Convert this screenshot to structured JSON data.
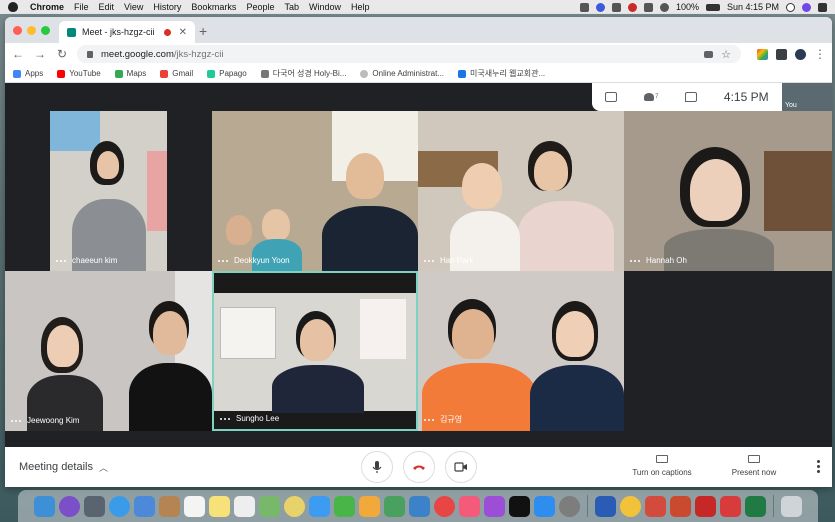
{
  "menubar": {
    "app": "Chrome",
    "items": [
      "File",
      "Edit",
      "View",
      "History",
      "Bookmarks",
      "People",
      "Tab",
      "Window",
      "Help"
    ],
    "battery": "100%",
    "datetime": "Sun 4:15 PM"
  },
  "browser": {
    "tab_title": "Meet - jks-hzgz-cii",
    "new_tab": "+",
    "url_host": "meet.google.com",
    "url_path": "/jks-hzgz-cii",
    "bookmarks": [
      {
        "label": "Apps",
        "color": "#4285f4"
      },
      {
        "label": "YouTube",
        "color": "#ff0000"
      },
      {
        "label": "Maps",
        "color": "#34a853"
      },
      {
        "label": "Gmail",
        "color": "#ea4335"
      },
      {
        "label": "Papago",
        "color": "#20c997"
      },
      {
        "label": "다국어 성경 Holy-Bi...",
        "color": "#777777"
      },
      {
        "label": "Online Administrat...",
        "color": "#888888"
      },
      {
        "label": "미국새누리 웹교회관...",
        "color": "#1a73e8"
      }
    ]
  },
  "meet": {
    "clock": "4:15 PM",
    "participant_count": "7",
    "self_label": "You",
    "participants": [
      {
        "name": "chaeeun kim",
        "bg": "#c8c3bd"
      },
      {
        "name": "Deokkyun Yoon",
        "bg": "#b8aa92"
      },
      {
        "name": "Han Park",
        "bg": "#d0c8bc"
      },
      {
        "name": "Hannah Oh",
        "bg": "#a59a8c"
      },
      {
        "name": "Jeewoong Kim",
        "bg": "#c9c5c2"
      },
      {
        "name": "Sungho Lee",
        "bg": "#d9d7d2"
      },
      {
        "name": "김규영",
        "bg": "#cfcac6"
      }
    ],
    "meeting_details": "Meeting details",
    "turn_on_captions": "Turn on captions",
    "present_now": "Present now"
  },
  "colors": {
    "active_speaker_border": "#7ed3c0",
    "hangup": "#d93025"
  }
}
